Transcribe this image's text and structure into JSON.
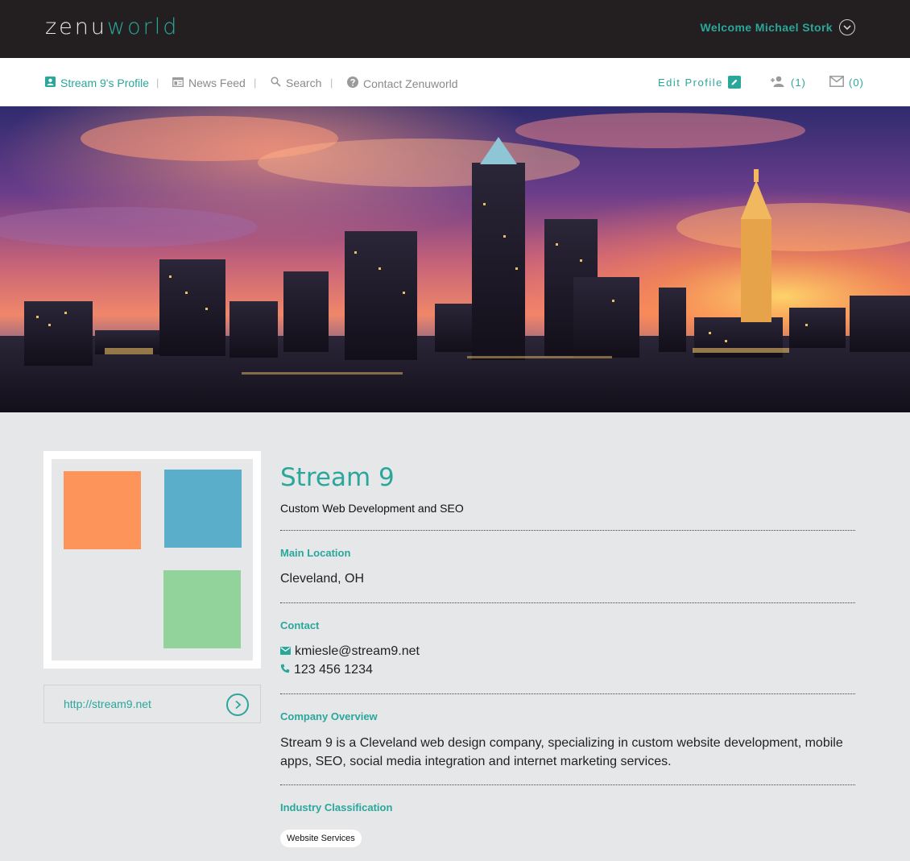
{
  "header": {
    "logo_part1": "zenu",
    "logo_part2": "world",
    "welcome": "Welcome Michael Stork",
    "colors": {
      "bg": "#231f20",
      "accent": "#2aa79b"
    }
  },
  "nav": {
    "items": [
      {
        "label": "Stream 9's Profile",
        "icon": "profile-icon",
        "active": true
      },
      {
        "label": "News Feed",
        "icon": "news-feed-icon",
        "active": false
      },
      {
        "label": "Search",
        "icon": "search-icon",
        "active": false
      },
      {
        "label": "Contact Zenuworld",
        "icon": "help-icon",
        "active": false
      }
    ],
    "separator": "|",
    "edit_profile": "Edit Profile",
    "connections_count": "(1)",
    "messages_count": "(0)"
  },
  "profile": {
    "name": "Stream 9",
    "tagline": "Custom Web Development and SEO",
    "website": "http://stream9.net",
    "logo_colors": {
      "orange": "#fd955a",
      "blue": "#5aaeca",
      "green": "#92d39b"
    },
    "sections": {
      "location_label": "Main Location",
      "location": "Cleveland, OH",
      "contact_label": "Contact",
      "email": "kmiesle@stream9.net",
      "phone": "123 456 1234",
      "overview_label": "Company Overview",
      "overview": "Stream 9 is a Cleveland web design company, specializing in custom website development, mobile apps, SEO, social media integration and internet marketing services.",
      "industry_label": "Industry Classification",
      "industry_tags": [
        "Website Services"
      ]
    }
  }
}
